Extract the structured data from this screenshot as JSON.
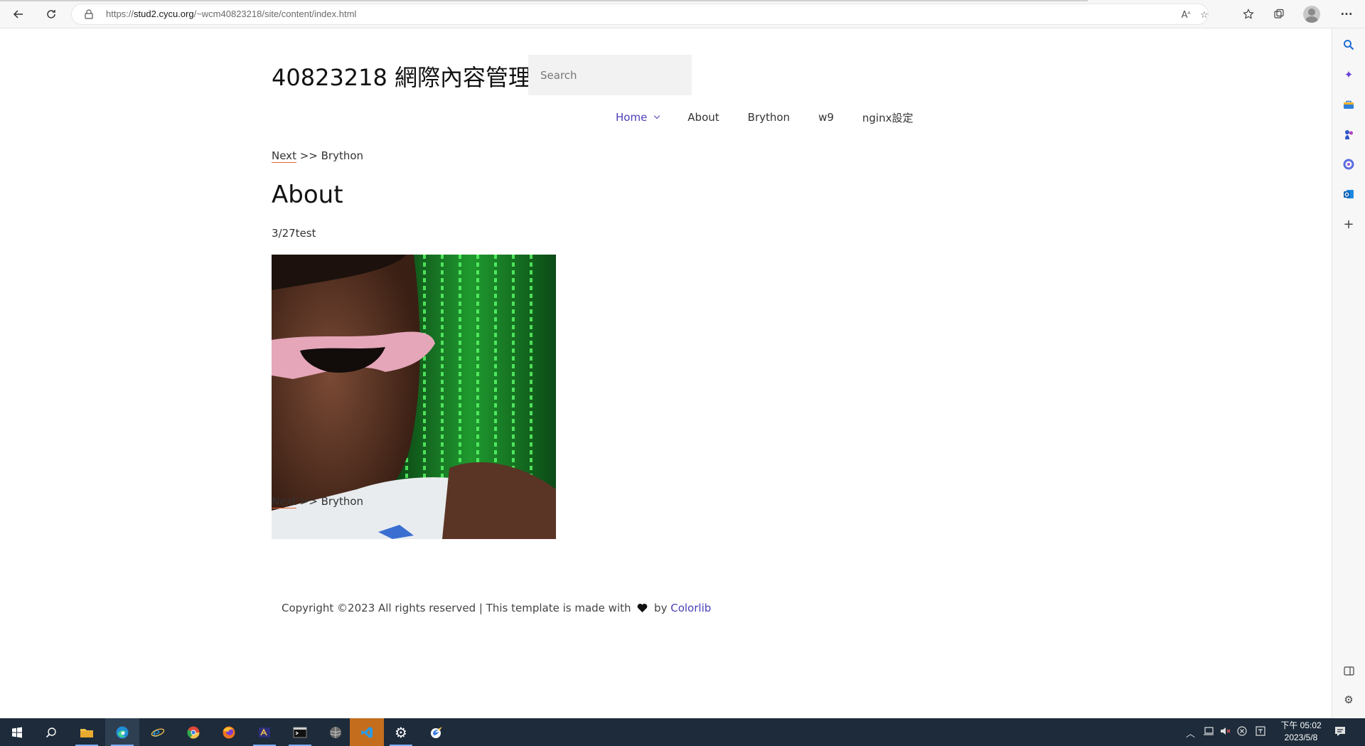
{
  "browser": {
    "url_prefix": "https://",
    "url_host": "stud2.cycu.org",
    "url_path": "/~wcm40823218/site/content/index.html"
  },
  "site": {
    "title": "40823218 網際內容管理",
    "search_placeholder": "Search"
  },
  "nav": {
    "items": [
      {
        "label": "Home",
        "active": true
      },
      {
        "label": "About",
        "active": false
      },
      {
        "label": "Brython",
        "active": false
      },
      {
        "label": "w9",
        "active": false
      },
      {
        "label": "nginx設定",
        "active": false
      }
    ]
  },
  "crumb_top": {
    "link": "Next",
    "rest": " >> Brython"
  },
  "content": {
    "heading": "About",
    "text": "3/27test"
  },
  "crumb_bottom": {
    "link": "Next",
    "rest": " >> Brython"
  },
  "footer": {
    "prefix": "Copyright ©2023 All rights reserved | This template is made with",
    "by": "by",
    "link": "Colorlib"
  },
  "taskbar": {
    "time": "下午 05:02",
    "date": "2023/5/8"
  },
  "colors": {
    "accent": "#4a3fb5",
    "link_underline": "#e8653e",
    "taskbar": "#1d2b3a"
  }
}
